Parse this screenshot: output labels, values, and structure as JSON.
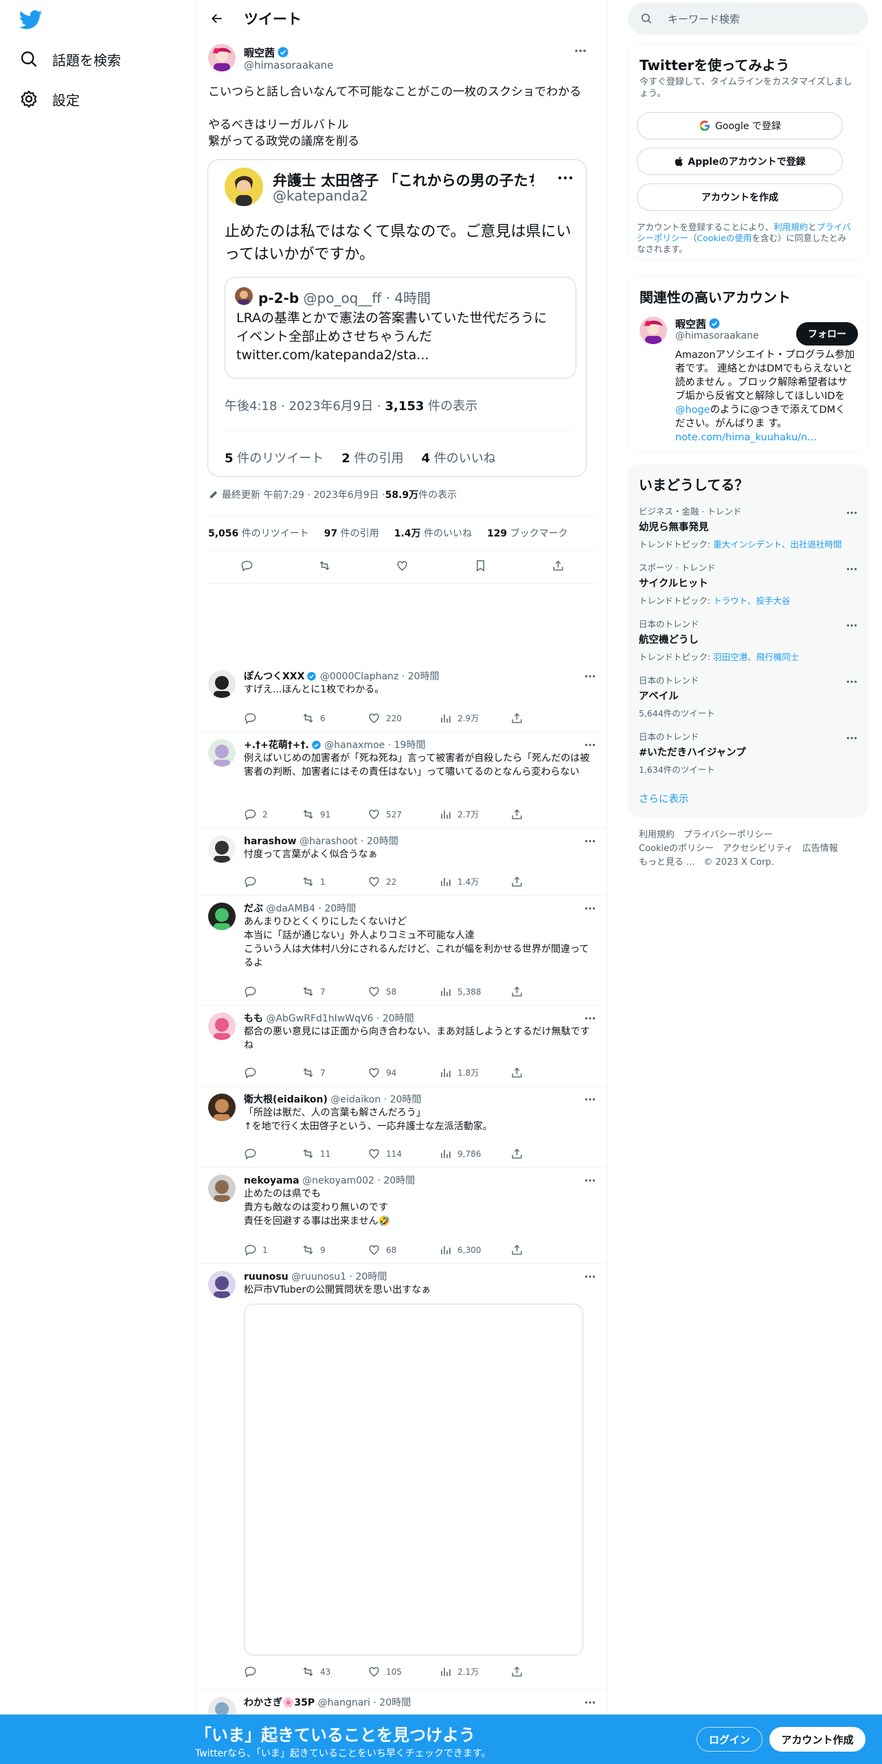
{
  "nav": {
    "explore": "話題を検索",
    "settings": "設定"
  },
  "header": {
    "title": "ツイート"
  },
  "main_tweet": {
    "name": "暇空茜",
    "handle": "@himasoraakane",
    "text": "こいつらと話し合いなんて不可能なことがこの一枚のスクショでわかる\n\nやるべきはリーガルバトル\n繋がってる政党の議席を削る",
    "quote": {
      "name": "弁護士 太田啓子 「これからの男の子たち...",
      "handle": "@katepanda2",
      "text": "止めたのは私ではなくて県なので。ご意見は県にいってはいかがですか。",
      "inner": {
        "name": "p-2-b",
        "handle_time": "@po_oq__ff · 4時間",
        "text": "LRAの基準とかで憲法の答案書いていた世代だろうに\nイベント全部止めさせちゃうんだ\ntwitter.com/katepanda2/sta..."
      },
      "time": "午後4:18 · 2023年6月9日 · ",
      "views_num": "3,153",
      "views_label": " 件の表示",
      "retweets_num": "5",
      "retweets_label": " 件のリツイート",
      "quotes_num": "2",
      "quotes_label": " 件の引用",
      "likes_num": "4",
      "likes_label": " 件のいいね"
    },
    "edited": "最終更新 午前7:29 · 2023年6月9日 · ",
    "views_num": "58.9万",
    "views_label": " 件の表示",
    "stats": {
      "retweets_num": "5,056",
      "retweets_label": " 件のリツイート",
      "quotes_num": "97",
      "quotes_label": " 件の引用",
      "likes_num": "1.4万",
      "likes_label": " 件のいいね",
      "bookmarks_num": "129",
      "bookmarks_label": " ブックマーク"
    }
  },
  "replies": [
    {
      "name": "ぽんつくXXX",
      "meta": "@0000Claphanz · 20時間",
      "text": "すげえ...ほんとに1枚でわかる。",
      "reply": "",
      "retweet": "6",
      "like": "220",
      "views": "2.9万"
    },
    {
      "name": "+.†+花萌†+†.",
      "meta": "@hanaxmoe · 19時間",
      "text": "例えばいじめの加害者が「死ね死ね」言って被害者が自殺したら「死んだのは被害者の判断、加害者にはその責任はない」って嘯いてるのとなんら変わらない",
      "reply": "2",
      "retweet": "91",
      "like": "527",
      "views": "2.7万"
    },
    {
      "name": "harashow",
      "meta": "@harashoot · 20時間",
      "text": "忖度って言葉がよく似合うなぁ",
      "reply": "",
      "retweet": "1",
      "like": "22",
      "views": "1.4万"
    },
    {
      "name": "だぶ",
      "meta": "@daAMB4 · 20時間",
      "text": "あんまりひとくくりにしたくないけど\n本当に「話が通じない」外人よりコミュ不可能な人達\nこういう人は大体村八分にされるんだけど、これが幅を利かせる世界が間違ってるよ",
      "reply": "",
      "retweet": "7",
      "like": "58",
      "views": "5,388"
    },
    {
      "name": "もも",
      "meta": "@AbGwRFd1hIwWqV6 · 20時間",
      "text": "都合の悪い意見には正面から向き合わない、まあ対話しようとするだけ無駄ですね",
      "reply": "",
      "retweet": "7",
      "like": "94",
      "views": "1.8万"
    },
    {
      "name": "衛大根(eidaikon)",
      "meta": "@eidaikon · 20時間",
      "text": "「所詮は獣だ、人の言葉も解さんだろう」\n↑を地で行く太田啓子という、一応弁護士な左派活動家。",
      "reply": "",
      "retweet": "11",
      "like": "114",
      "views": "9,786"
    },
    {
      "name": "nekoyama",
      "meta": "@nekoyam002 · 20時間",
      "text": "止めたのは県でも\n貴方も敵なのは変わり無いのです\n責任を回避する事は出来ません🤣",
      "reply": "1",
      "retweet": "9",
      "like": "68",
      "views": "6,300"
    },
    {
      "name": "ruunosu",
      "meta": "@ruunosu1 · 20時間",
      "text": "松戸市VTuberの公開質問状を思い出すなぁ",
      "reply": "",
      "retweet": "43",
      "like": "105",
      "views": "2.1万"
    },
    {
      "name": "わかさぎ🌸35P",
      "meta": "@hangnari · 20時間",
      "text": "",
      "reply": "",
      "retweet": "",
      "like": "",
      "views": ""
    }
  ],
  "right": {
    "search_placeholder": "キーワード検索",
    "signup": {
      "title": "Twitterを使ってみよう",
      "note": "今すぐ登録して、タイムラインをカスタマイズしましょう。",
      "google": "Google で登録",
      "apple": "Appleのアカウントで登録",
      "create": "アカウントを作成",
      "terms_pre": "アカウントを登録することにより、",
      "terms_link1": "利用規約",
      "terms_mid": "と",
      "terms_link2": "プライバシーポリシー",
      "terms_paren_open": "（",
      "terms_link3": "Cookieの使用",
      "terms_post": "を含む）に同意したとみなされます。"
    },
    "related": {
      "title": "関連性の高いアカウント",
      "name": "暇空茜",
      "handle": "@himasoraakane",
      "follow": "フォロー",
      "bio_1": "Amazonアソシエイト・プログラム参加者です。 連絡とかはDMでもらえないと読めません 。ブロック解除希望者はサブ垢から反省文と解除してほしいIDを",
      "bio_mention": "@hoge",
      "bio_2": "のように@つきで添えてDMください。がんばりま す。",
      "bio_link": "note.com/hima_kuuhaku/n..."
    },
    "trends": {
      "title": "いまどうしてる？",
      "items": [
        {
          "cat": "ビジネス・金融 · トレンド",
          "name": "幼児ら無事発見",
          "sub_label": "トレンドトピック: ",
          "sub_links": "重大インシデント、出社退社時間"
        },
        {
          "cat": "スポーツ · トレンド",
          "name": "サイクルヒット",
          "sub_label": "トレンドトピック: ",
          "sub_links": "トラウト、投手大谷"
        },
        {
          "cat": "日本のトレンド",
          "name": "航空機どうし",
          "sub_label": "トレンドトピック: ",
          "sub_links": "羽田空港、飛行機同士"
        },
        {
          "cat": "日本のトレンド",
          "name": "アベイル",
          "sub_label": "5,644件のツイート",
          "sub_links": ""
        },
        {
          "cat": "日本のトレンド",
          "name": "#いただきハイジャンプ",
          "sub_label": "1,634件のツイート",
          "sub_links": ""
        }
      ],
      "show_more": "さらに表示"
    },
    "footer": {
      "line1": "利用規約　プライバシーポリシー",
      "line2": "Cookieのポリシー　アクセシビリティ　広告情報",
      "line3": "もっと見る ...　© 2023 X Corp."
    }
  },
  "bottombar": {
    "title": "「いま」起きていることを見つけよう",
    "subtitle": "Twitterなら、「いま」起きていることをいち早くチェックできます。",
    "login": "ログイン",
    "signup": "アカウント作成"
  }
}
